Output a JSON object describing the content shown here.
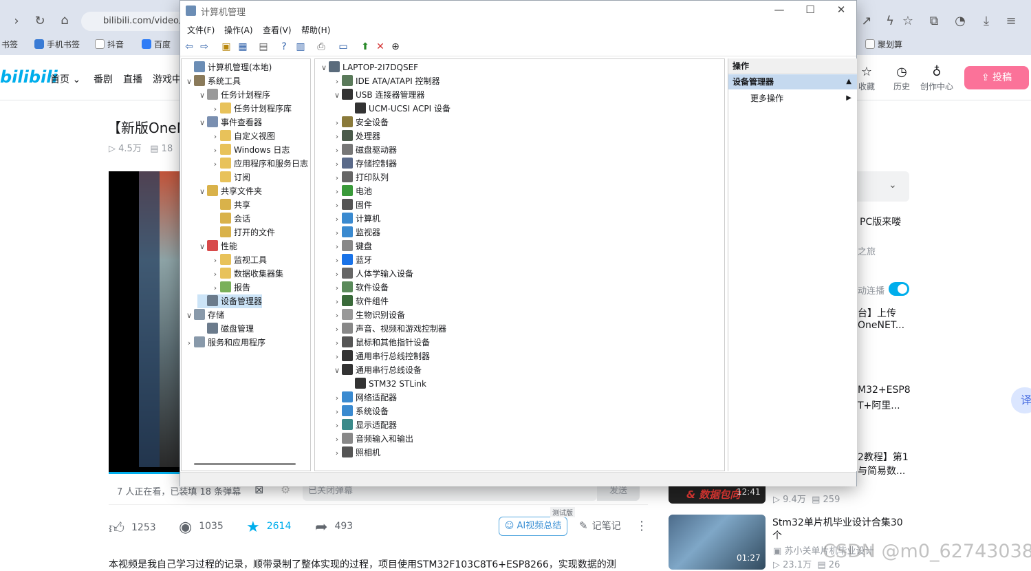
{
  "browser": {
    "url": "bilibili.com/video/B",
    "bookmarks": [
      "书签",
      "手机书签",
      "抖音",
      "百度",
      "聚划算"
    ]
  },
  "bili": {
    "logo": "bilibili",
    "nav": [
      "首页",
      "番剧",
      "直播",
      "游戏中"
    ],
    "nav_right": [
      "收藏",
      "历史",
      "创作中心"
    ],
    "upload": "投稿",
    "video_title": "【新版OneNe",
    "views": "4.5万",
    "danmaku_count": "18",
    "watching": "7 人正在看，已装填 18 条弹幕",
    "dm_placeholder": "已关闭弹幕",
    "dm_send": "发送",
    "likes": "1253",
    "coins": "1035",
    "favs": "2614",
    "shares": "493",
    "ai_summary": "AI视频总结",
    "ai_badge": "测试版",
    "notes": "记笔记",
    "description": "本视频是我自己学习过程的记录，顺带录制了整体实现的过程，项目使用STM32F103C8T6+ESP8266，实现数据的测",
    "right": {
      "t1": "PC版来喽",
      "t2": "之旅",
      "autoplay": "动连播",
      "r1a": "台】上传",
      "r1b": "OneNET...",
      "r2a": "M32+ESP8",
      "r2b": "T+阿里...",
      "r3a": "2教程】第1",
      "r3b": "与简易数...",
      "r4_dur": "12:41",
      "r4_views": "9.4万",
      "r4_dm": "259",
      "r5_title_a": "Stm32单片机毕业设计合集30",
      "r5_title_b": "个",
      "r5_up": "苏小关单片机毕业设计",
      "r5_dur": "01:27",
      "r5_views": "23.1万",
      "r5_dm": "26",
      "r4_thumb_text": "& 数据包向"
    },
    "watermark": "CSDN @m0_62743038"
  },
  "mmc": {
    "title": "计算机管理",
    "menu": [
      "文件(F)",
      "操作(A)",
      "查看(V)",
      "帮助(H)"
    ],
    "tree": [
      {
        "label": "计算机管理(本地)",
        "lvl": 0,
        "ex": "",
        "icon": "computer-mgmt-icon"
      },
      {
        "label": "系统工具",
        "lvl": 0,
        "ex": "∨",
        "icon": "tools-icon"
      },
      {
        "label": "任务计划程序",
        "lvl": 1,
        "ex": "∨",
        "icon": "clock-icon"
      },
      {
        "label": "任务计划程序库",
        "lvl": 2,
        "ex": "›",
        "icon": "folder-icon"
      },
      {
        "label": "事件查看器",
        "lvl": 1,
        "ex": "∨",
        "icon": "event-icon"
      },
      {
        "label": "自定义视图",
        "lvl": 2,
        "ex": "›",
        "icon": "folder-icon"
      },
      {
        "label": "Windows 日志",
        "lvl": 2,
        "ex": "›",
        "icon": "folder-icon"
      },
      {
        "label": "应用程序和服务日志",
        "lvl": 2,
        "ex": "›",
        "icon": "folder-icon"
      },
      {
        "label": "订阅",
        "lvl": 2,
        "ex": "",
        "icon": "subscription-icon"
      },
      {
        "label": "共享文件夹",
        "lvl": 1,
        "ex": "∨",
        "icon": "share-icon"
      },
      {
        "label": "共享",
        "lvl": 2,
        "ex": "",
        "icon": "share-icon"
      },
      {
        "label": "会话",
        "lvl": 2,
        "ex": "",
        "icon": "share-icon"
      },
      {
        "label": "打开的文件",
        "lvl": 2,
        "ex": "",
        "icon": "share-icon"
      },
      {
        "label": "性能",
        "lvl": 1,
        "ex": "∨",
        "icon": "perf-icon"
      },
      {
        "label": "监视工具",
        "lvl": 2,
        "ex": "›",
        "icon": "folder-icon"
      },
      {
        "label": "数据收集器集",
        "lvl": 2,
        "ex": "›",
        "icon": "folder-icon"
      },
      {
        "label": "报告",
        "lvl": 2,
        "ex": "›",
        "icon": "report-icon"
      },
      {
        "label": "设备管理器",
        "lvl": 1,
        "ex": "",
        "icon": "device-manager-icon",
        "sel": true
      },
      {
        "label": "存储",
        "lvl": 0,
        "ex": "∨",
        "icon": "storage-icon"
      },
      {
        "label": "磁盘管理",
        "lvl": 1,
        "ex": "",
        "icon": "disk-icon"
      },
      {
        "label": "服务和应用程序",
        "lvl": 0,
        "ex": "›",
        "icon": "services-icon"
      }
    ],
    "devices": [
      {
        "label": "LAPTOP-2I7DQSEF",
        "lvl": 0,
        "ex": "∨",
        "icon": "computer-icon"
      },
      {
        "label": "IDE ATA/ATAPI 控制器",
        "lvl": 1,
        "ex": "›",
        "icon": "ide-icon"
      },
      {
        "label": "USB 连接器管理器",
        "lvl": 1,
        "ex": "∨",
        "icon": "usb-icon"
      },
      {
        "label": "UCM-UCSI ACPI 设备",
        "lvl": 2,
        "ex": "",
        "icon": "usb-icon"
      },
      {
        "label": "安全设备",
        "lvl": 1,
        "ex": "›",
        "icon": "security-icon"
      },
      {
        "label": "处理器",
        "lvl": 1,
        "ex": "›",
        "icon": "cpu-icon"
      },
      {
        "label": "磁盘驱动器",
        "lvl": 1,
        "ex": "›",
        "icon": "drive-icon"
      },
      {
        "label": "存储控制器",
        "lvl": 1,
        "ex": "›",
        "icon": "storage-ctrl-icon"
      },
      {
        "label": "打印队列",
        "lvl": 1,
        "ex": "›",
        "icon": "printer-icon"
      },
      {
        "label": "电池",
        "lvl": 1,
        "ex": "›",
        "icon": "battery-icon"
      },
      {
        "label": "固件",
        "lvl": 1,
        "ex": "›",
        "icon": "firmware-icon"
      },
      {
        "label": "计算机",
        "lvl": 1,
        "ex": "›",
        "icon": "monitor-icon"
      },
      {
        "label": "监视器",
        "lvl": 1,
        "ex": "›",
        "icon": "monitor-icon"
      },
      {
        "label": "键盘",
        "lvl": 1,
        "ex": "›",
        "icon": "keyboard-icon"
      },
      {
        "label": "蓝牙",
        "lvl": 1,
        "ex": "›",
        "icon": "bluetooth-icon"
      },
      {
        "label": "人体学输入设备",
        "lvl": 1,
        "ex": "›",
        "icon": "hid-icon"
      },
      {
        "label": "软件设备",
        "lvl": 1,
        "ex": "›",
        "icon": "software-icon"
      },
      {
        "label": "软件组件",
        "lvl": 1,
        "ex": "›",
        "icon": "component-icon"
      },
      {
        "label": "生物识别设备",
        "lvl": 1,
        "ex": "›",
        "icon": "fingerprint-icon"
      },
      {
        "label": "声音、视频和游戏控制器",
        "lvl": 1,
        "ex": "›",
        "icon": "speaker-icon"
      },
      {
        "label": "鼠标和其他指针设备",
        "lvl": 1,
        "ex": "›",
        "icon": "mouse-icon"
      },
      {
        "label": "通用串行总线控制器",
        "lvl": 1,
        "ex": "›",
        "icon": "usb-icon"
      },
      {
        "label": "通用串行总线设备",
        "lvl": 1,
        "ex": "∨",
        "icon": "usb-icon"
      },
      {
        "label": "STM32 STLink",
        "lvl": 2,
        "ex": "",
        "icon": "usb-icon"
      },
      {
        "label": "网络适配器",
        "lvl": 1,
        "ex": "›",
        "icon": "network-icon"
      },
      {
        "label": "系统设备",
        "lvl": 1,
        "ex": "›",
        "icon": "system-icon"
      },
      {
        "label": "显示适配器",
        "lvl": 1,
        "ex": "›",
        "icon": "display-icon"
      },
      {
        "label": "音频输入和输出",
        "lvl": 1,
        "ex": "›",
        "icon": "speaker-icon"
      },
      {
        "label": "照相机",
        "lvl": 1,
        "ex": "›",
        "icon": "camera-icon"
      }
    ],
    "actions_header": "操作",
    "actions_section": "设备管理器",
    "more_actions": "更多操作"
  },
  "colors": {
    "accent": "#fb7299",
    "bili_blue": "#00aeec",
    "mmc_sel": "#cce4f7",
    "mmc_section": "#c5d9ef"
  }
}
